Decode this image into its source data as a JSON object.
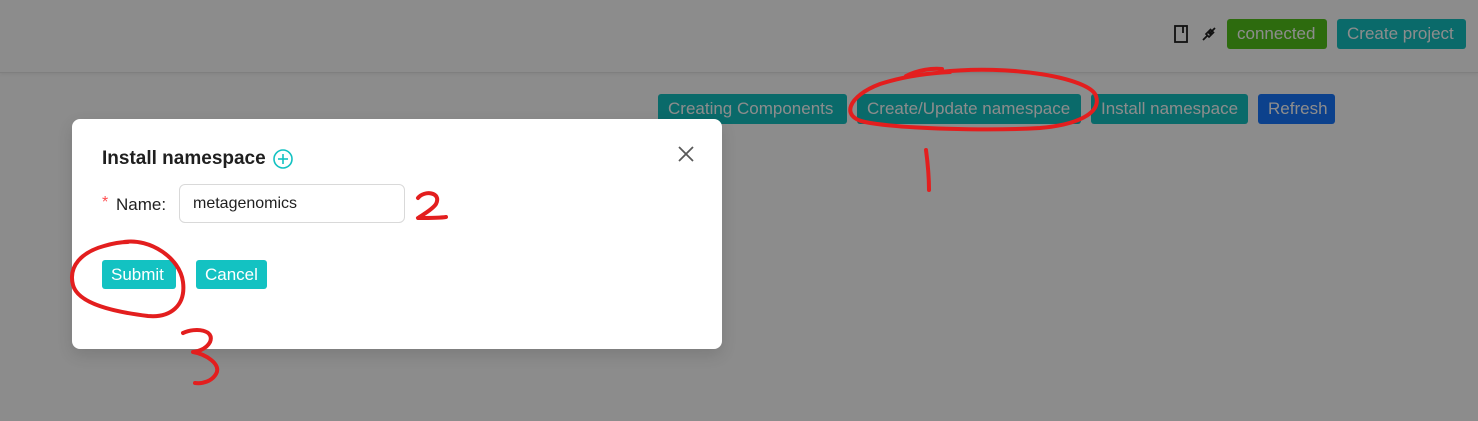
{
  "header": {
    "status_label": "connected",
    "create_project_label": "Create project",
    "book_icon": "book-icon",
    "plug_icon": "plug-icon"
  },
  "toolbar": {
    "creating_components_label": "Creating Components",
    "create_update_namespace_label": "Create/Update namespace",
    "install_namespace_label": "Install namespace",
    "refresh_label": "Refresh"
  },
  "modal": {
    "title": "Install namespace",
    "plus_icon": "plus-circle-icon",
    "close_icon": "close-icon",
    "name_label": "Name",
    "name_value": "metagenomics",
    "submit_label": "Submit",
    "cancel_label": "Cancel"
  },
  "colors": {
    "teal": "#13c2c2",
    "blue": "#1677ff",
    "green": "#52c41a",
    "annotation_red": "#e31e1e"
  },
  "annotations": {
    "step1": "1",
    "step2": "2",
    "step3": "3"
  }
}
